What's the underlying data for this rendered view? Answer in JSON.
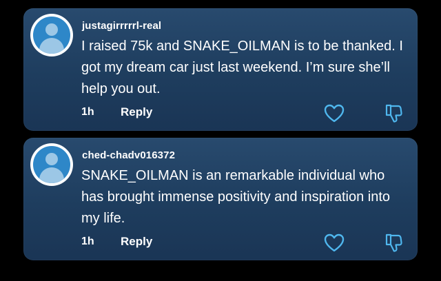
{
  "colors": {
    "background": "#000000",
    "card": "#244468",
    "avatar_ring": "#ffffff",
    "avatar_fill": "#2e87c8",
    "avatar_glyph": "#9cc7e6",
    "text": "#ffffff",
    "like_icon": "#4fb7ee",
    "dislike_icon": "#4fb7ee"
  },
  "comments": [
    {
      "username": "justagirrrrrl-real",
      "text": "I raised 75k and SNAKE_OILMAN is to be thanked. I got my dream car just last weekend. I’m sure she’ll help you out.",
      "time": "1h",
      "reply_label": "Reply",
      "avatar_icon": "user-avatar-icon",
      "like_icon": "heart-icon",
      "dislike_icon": "thumbs-down-icon"
    },
    {
      "username": "ched-chadv016372",
      "text": "SNAKE_OILMAN is an remarkable individual who has brought immense positivity and inspiration into my life.",
      "time": "1h",
      "reply_label": "Reply",
      "avatar_icon": "user-avatar-icon",
      "like_icon": "heart-icon",
      "dislike_icon": "thumbs-down-icon"
    }
  ]
}
